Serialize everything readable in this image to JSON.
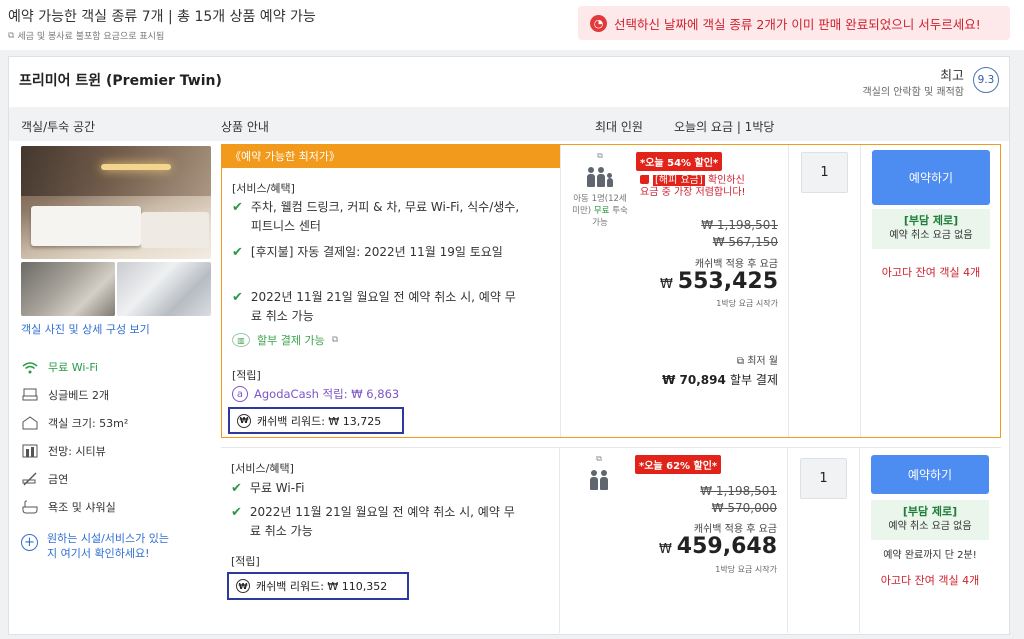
{
  "header": {
    "title": "예약 가능한 객실 종류 7개 | 총 15개 상품 예약 가능",
    "subtitle": "세금 및 봉사료 불포함 요금으로 표시됨",
    "alert": "선택하신 날짜에 객실 종류 2개가 이미 판매 완료되었으니 서두르세요!"
  },
  "room": {
    "name": "프리미어 트윈 (Premier Twin)",
    "rating_word": "최고",
    "rating_sub": "객실의 안락함 및 쾌적함",
    "rating_score": "9.3"
  },
  "columns": {
    "room": "객실/투숙 공간",
    "offer": "상품 안내",
    "occupancy": "최대 인원",
    "price": "오늘의 요금 | 1박당"
  },
  "left": {
    "photo_link": "객실 사진 및 상세 구성 보기",
    "amenities": [
      {
        "label": "무료 Wi-Fi",
        "icon": "wifi-icon"
      },
      {
        "label": "싱글베드 2개",
        "icon": "bed-icon"
      },
      {
        "label": "객실 크기: 53m²",
        "icon": "room-size-icon"
      },
      {
        "label": "전망: 시티뷰",
        "icon": "city-view-icon"
      },
      {
        "label": "금연",
        "icon": "no-smoking-icon"
      },
      {
        "label": "욕조 및 샤워실",
        "icon": "bath-icon"
      }
    ],
    "more_line1": "원하는 시설/서비스가 있는",
    "more_line2": "지 여기서 확인하세요!"
  },
  "offer1": {
    "ribbon": "《예약 가능한 최저가》",
    "services_label": "[서비스/혜택]",
    "features": [
      "주차, 웰컴 드링크, 커피 & 차, 무료 Wi-Fi, 식수/생수, 피트니스 센터",
      "[후지불] 자동 결제일: 2022년 11월 19일 토요일",
      "2022년 11월 21일 월요일 전 예약 취소 시, 예약 무료 취소 가능"
    ],
    "ext_mark": "⧉",
    "installment": "할부 결제 가능",
    "reward_label": "[적립]",
    "agoda_cash": "AgodaCash 적립: ₩ 6,863",
    "cashback": "캐쉬백 리워드: ₩ 13,725",
    "child_note_1": "아동 1명(12세 미만)",
    "child_note_free": "무료",
    "child_note_2": "투숙 가능",
    "discount": "*오늘 54% 할인*",
    "happy_1": "[해피 요금]",
    "happy_2": "확인하신 요금 중 가장 저렴합니다!",
    "original1": "₩ 1,198,501",
    "original2": "₩ 567,150",
    "after_label": "캐쉬백 적용 후 요금",
    "currency": "₩",
    "price": "553,425",
    "from": "1박당 요금 시작가",
    "lowest": "⧉ 최저 월",
    "installment_price": "₩ 70,894",
    "installment_suffix": "할부 결제",
    "qty": "1",
    "book": "예약하기",
    "free_title": "[부담 제로]",
    "free_sub": "예약 취소 요금 없음",
    "rooms_left": "아고다 잔여 객실 4개"
  },
  "offer2": {
    "services_label": "[서비스/혜택]",
    "features": [
      "무료 Wi-Fi",
      "2022년 11월 21일 월요일 전 예약 취소 시, 예약 무료 취소 가능"
    ],
    "reward_label": "[적립]",
    "cashback": "캐쉬백 리워드: ₩ 110,352",
    "discount": "*오늘 62% 할인*",
    "original1": "₩ 1,198,501",
    "original2": "₩ 570,000",
    "after_label": "캐쉬백 적용 후 요금",
    "currency": "₩",
    "price": "459,648",
    "from": "1박당 요금 시작가",
    "qty": "1",
    "book": "예약하기",
    "free_title": "[부담 제로]",
    "free_sub": "예약 취소 요금 없음",
    "deadline": "예약 완료까지 단 2분!",
    "rooms_left": "아고다 잔여 객실 4개"
  },
  "colors": {
    "accent_orange": "#f29a1b",
    "book_blue": "#4d8cf0",
    "green": "#2a9a45",
    "red": "#e2231a"
  }
}
